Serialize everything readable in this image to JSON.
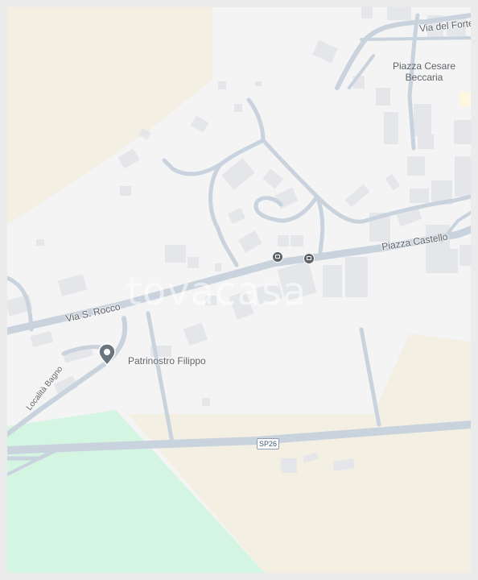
{
  "map": {
    "streets": [
      {
        "id": "via-s-rocco",
        "label": "Via S. Rocco"
      },
      {
        "id": "piazza-castello",
        "label": "Piazza Castello"
      },
      {
        "id": "via-del-forte",
        "label": "Via del Forte"
      },
      {
        "id": "localita-bagno",
        "label": "Località Bagno"
      }
    ],
    "places": [
      {
        "id": "piazza-cesare-beccaria",
        "line1": "Piazza Cesare",
        "line2": "Beccaria"
      }
    ],
    "poi": {
      "label": "Patrinostro Filippo",
      "icon": "map-pin-icon"
    },
    "road_shield": {
      "label": "SP26"
    },
    "transit": [
      {
        "icon": "bus-stop-icon"
      },
      {
        "icon": "bus-stop-icon"
      }
    ],
    "watermark": "tovacasa",
    "colors": {
      "background": "#f4f4f5",
      "road": "#c9d3de",
      "building": "#e4e6ea",
      "park": "#d5f5e3",
      "land": "#f4efe3",
      "text": "#5f6368"
    }
  }
}
